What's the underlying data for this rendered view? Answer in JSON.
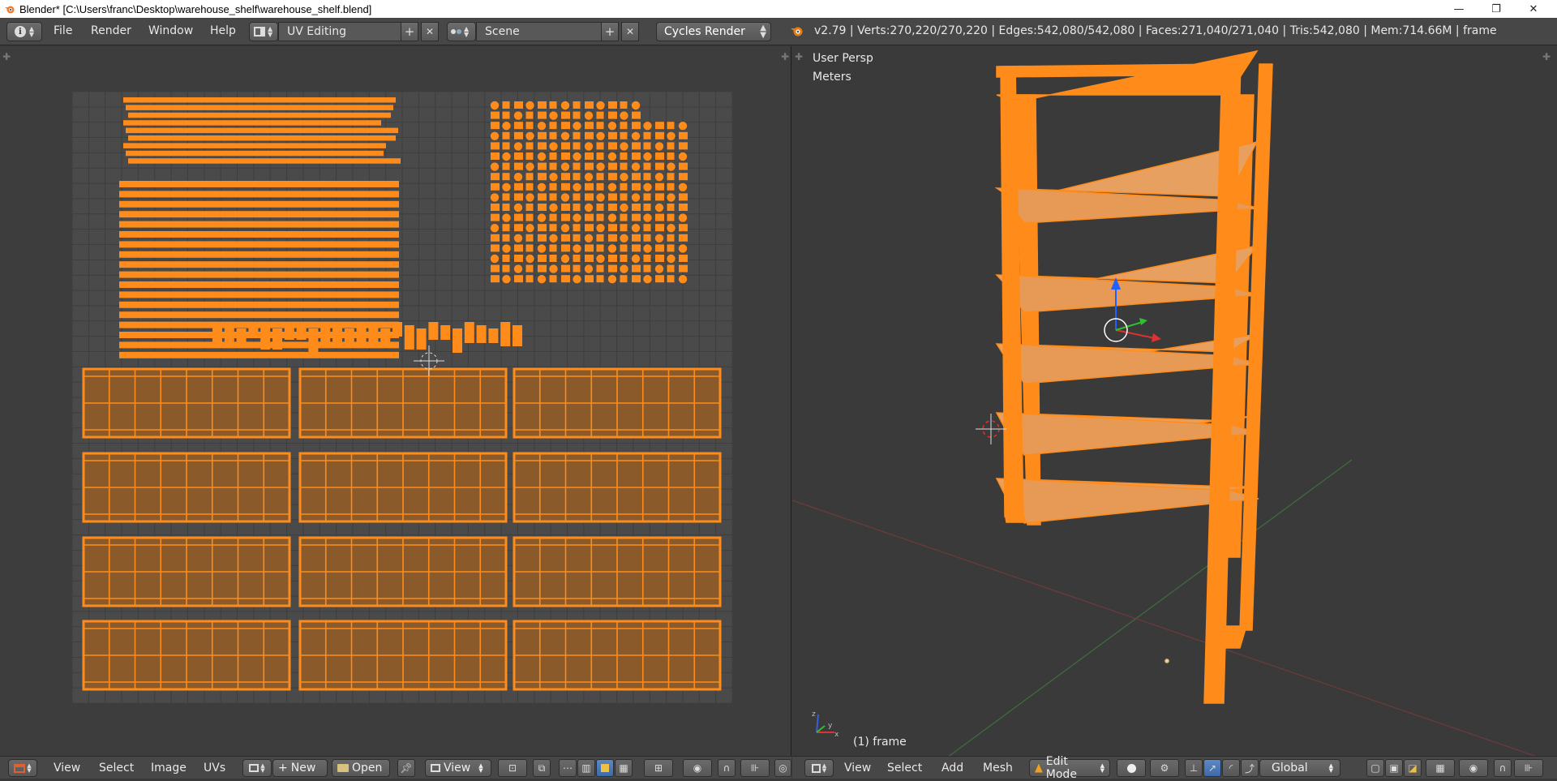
{
  "window": {
    "title": "Blender* [C:\\Users\\franc\\Desktop\\warehouse_shelf\\warehouse_shelf.blend]",
    "controls": {
      "minimize": "—",
      "restore": "❐",
      "close": "✕"
    }
  },
  "info_header": {
    "menus": [
      "File",
      "Render",
      "Window",
      "Help"
    ],
    "layout_name": "UV Editing",
    "scene_name": "Scene",
    "render_engine": "Cycles Render",
    "stats": "v2.79 | Verts:270,220/270,220 | Edges:542,080/542,080 | Faces:271,040/271,040 | Tris:542,080 | Mem:714.66M | frame"
  },
  "viewport": {
    "view_name": "User Persp",
    "units": "Meters",
    "object_label": "(1) frame"
  },
  "uv_header": {
    "menus": [
      "View",
      "Select",
      "Image",
      "UVs"
    ],
    "new_label": "New",
    "open_label": "Open",
    "view_label": "View"
  },
  "view3d_header": {
    "menus": [
      "View",
      "Select",
      "Add",
      "Mesh"
    ],
    "mode": "Edit Mode",
    "orientation": "Global"
  },
  "colors": {
    "mesh_orange": "#ff8c1a",
    "uv_grid_bg": "#4a4a4a",
    "face_fill": "#8a5a2a",
    "accent_blue": "#4a78b8"
  }
}
